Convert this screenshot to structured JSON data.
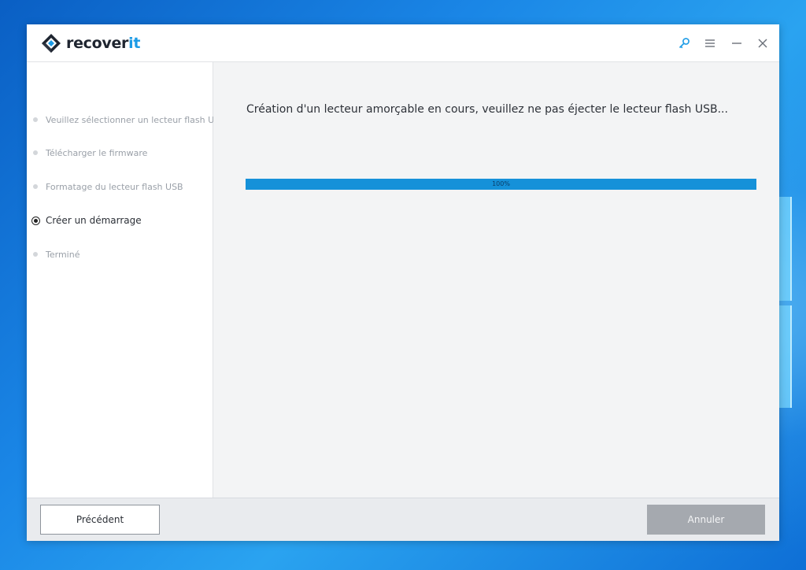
{
  "app": {
    "name_part1": "recover",
    "name_part2": "it",
    "accent_color": "#1c9be6"
  },
  "titlebar": {
    "icons": [
      "key-icon",
      "menu-icon",
      "minimize-icon",
      "close-icon"
    ]
  },
  "sidebar": {
    "steps": [
      {
        "label": "Veuillez sélectionner un lecteur flash USB",
        "state": "pending"
      },
      {
        "label": "Télécharger le firmware",
        "state": "pending"
      },
      {
        "label": "Formatage du lecteur flash USB",
        "state": "pending"
      },
      {
        "label": "Créer un démarrage",
        "state": "active"
      },
      {
        "label": "Terminé",
        "state": "pending"
      }
    ]
  },
  "main": {
    "message": "Création d'un lecteur amorçable en cours, veuillez ne pas éjecter le lecteur flash USB...",
    "progress": {
      "value": 100,
      "label": "100%",
      "color": "#1591d9"
    }
  },
  "footer": {
    "prev_label": "Précédent",
    "cancel_label": "Annuler"
  }
}
